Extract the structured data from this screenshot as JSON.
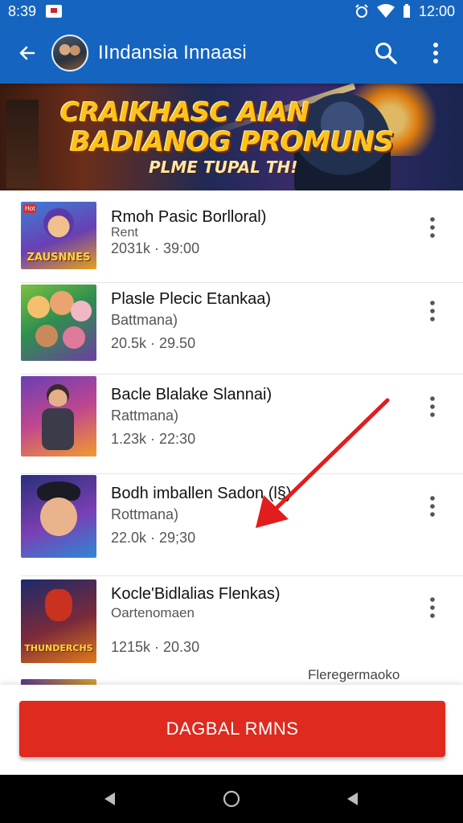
{
  "status_bar": {
    "time": "8:39",
    "clock_right": "12:00",
    "icons": [
      "notification-icon",
      "alarm-icon",
      "wifi-icon",
      "battery-icon"
    ]
  },
  "app_bar": {
    "title": "IIndansia Innaasi",
    "icons": [
      "back-arrow-icon",
      "search-icon",
      "more-vert-icon"
    ],
    "color": "#1565c0"
  },
  "banner": {
    "line1": "CRAIKHASC AIAN",
    "line2": "BADIANOG PROMUNS",
    "line3": "PLME TUPAL TH!"
  },
  "items": [
    {
      "title": "Rmoh Pasic Borlloral)",
      "subtitle": "Rent",
      "meta": "2031k · 39:00",
      "thumb_label": "ZAUSNNES",
      "thumb_badge": "Hot"
    },
    {
      "title": "Plasle Plecic Etankaa)",
      "subtitle": "Battmana)",
      "meta": "20.5k · 29.50",
      "thumb_label": "",
      "thumb_badge": ""
    },
    {
      "title": "Bacle Blalake Slannai)",
      "subtitle": "Rattmana)",
      "meta": "1.23k · 22:30",
      "thumb_label": "",
      "thumb_badge": ""
    },
    {
      "title": "Bodh imballen Sadon (l§)",
      "subtitle": "Rottmana)",
      "meta": "22.0k · 29;30",
      "thumb_label": "",
      "thumb_badge": ""
    },
    {
      "title": "Kocle'Bidlalias Flenkas)",
      "subtitle": "Oartenomaen",
      "meta": "1215k · 20.30",
      "thumb_label": "THUNDERCHS",
      "thumb_badge": ""
    }
  ],
  "footer_note": "Fleregermaoko",
  "cta": {
    "label": "DAGBAL RMNS",
    "color": "#de2a1f"
  },
  "nav": {
    "icons": [
      "nav-back-icon",
      "nav-home-icon",
      "nav-recent-icon"
    ]
  },
  "overlay": {
    "arrow_color": "#e11d1d"
  }
}
